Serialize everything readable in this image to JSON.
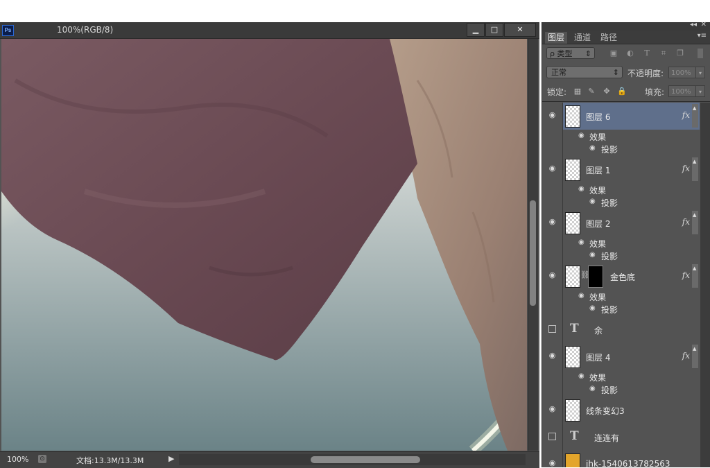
{
  "document": {
    "app_logo": "Ps",
    "title": "100%(RGB/8)",
    "controls": {
      "minimize": "▁",
      "maximize": "□",
      "close": "✕"
    }
  },
  "status": {
    "zoom": "100%",
    "doc_size": "文档:13.3M/13.3M"
  },
  "panel": {
    "top_icons": {
      "collapse": "◂◂",
      "close": "✕"
    },
    "tabs": [
      "图层",
      "通道",
      "路径"
    ],
    "menu_icon": "▾≡",
    "filter": {
      "kind": "ρ 类型",
      "arrow": "⇕"
    },
    "blend_mode": "正常",
    "opacity_label": "不透明度:",
    "opacity_value": "100%",
    "lock_label": "锁定:",
    "fill_label": "填充:",
    "fill_value": "100%",
    "filter_icons": [
      "image-icon",
      "adjustment-icon",
      "type-icon",
      "shape-icon",
      "smart-object-icon"
    ],
    "lock_icons": [
      "lock-transparent-icon",
      "lock-brush-icon",
      "lock-move-icon",
      "lock-all-icon"
    ]
  },
  "layers": [
    {
      "name": "图层 6",
      "visible": true,
      "selected": true,
      "fx": "fx",
      "effects": {
        "label": "效果",
        "items": [
          "投影"
        ]
      }
    },
    {
      "name": "图层 1",
      "visible": true,
      "fx": "fx",
      "effects": {
        "label": "效果",
        "items": [
          "投影"
        ]
      }
    },
    {
      "name": "图层 2",
      "visible": true,
      "fx": "fx",
      "effects": {
        "label": "效果",
        "items": [
          "投影"
        ]
      }
    },
    {
      "name": "金色底",
      "visible": true,
      "fx": "fx",
      "masked": true,
      "effects": {
        "label": "效果",
        "items": [
          "投影"
        ]
      }
    },
    {
      "name": "余",
      "visible": false,
      "type": "text",
      "glyph": "T"
    },
    {
      "name": "图层 4",
      "visible": true,
      "fx": "fx",
      "effects": {
        "label": "效果",
        "items": [
          "投影"
        ]
      }
    },
    {
      "name": "线条变幻3",
      "visible": true
    },
    {
      "name": "连连有",
      "visible": false,
      "type": "text",
      "glyph": "T"
    },
    {
      "name": "jhk-1540613782563",
      "visible": true,
      "gold": true
    }
  ],
  "colors": {
    "panel_bg": "#535353",
    "selected_row": "#5f6f8b",
    "cloth_dark": "#6b4a52",
    "cloth_tan": "#9c8274",
    "bg_top": "#dfe4e2",
    "bg_bottom": "#6e868a"
  }
}
